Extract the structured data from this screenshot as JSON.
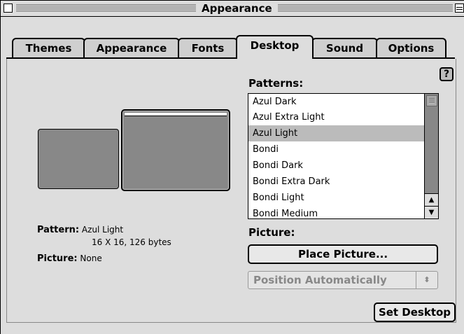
{
  "window": {
    "title": "Appearance"
  },
  "tabs": [
    {
      "label": "Themes",
      "active": false
    },
    {
      "label": "Appearance",
      "active": false
    },
    {
      "label": "Fonts",
      "active": false
    },
    {
      "label": "Desktop",
      "active": true
    },
    {
      "label": "Sound",
      "active": false
    },
    {
      "label": "Options",
      "active": false
    }
  ],
  "help": {
    "label": "?"
  },
  "info": {
    "pattern_key": "Pattern:",
    "pattern_value": "Azul Light",
    "pattern_detail": "16 X 16, 126 bytes",
    "picture_key": "Picture:",
    "picture_value": "None"
  },
  "patterns": {
    "label": "Patterns:",
    "items": [
      "Azul Dark",
      "Azul Extra Light",
      "Azul Light",
      "Bondi",
      "Bondi Dark",
      "Bondi Extra Dark",
      "Bondi Light",
      "Bondi Medium"
    ],
    "selected": "Azul Light"
  },
  "picture": {
    "label": "Picture:",
    "place_button": "Place Picture...",
    "position_popup": "Position Automatically"
  },
  "set_desktop_button": "Set Desktop",
  "colors": {
    "window_bg": "#dddddd",
    "preview": "#888888",
    "selection": "#bbbbbb"
  }
}
